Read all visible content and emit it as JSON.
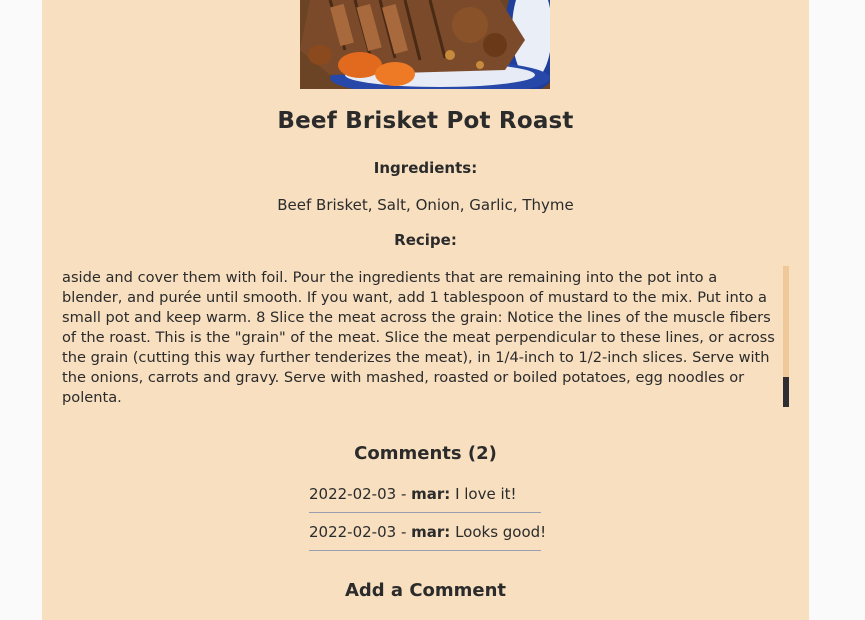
{
  "recipe": {
    "title": "Beef Brisket Pot Roast",
    "ingredients_label": "Ingredients:",
    "ingredients": "Beef Brisket, Salt, Onion, Garlic, Thyme",
    "recipe_label": "Recipe:",
    "recipe_text": "aside and cover them with foil. Pour the ingredients that are remaining into the pot into a blender, and purée until smooth. If you want, add 1 tablespoon of mustard to the mix. Put into a small pot and keep warm. 8 Slice the meat across the grain: Notice the lines of the muscle fibers of the roast. This is the \"grain\" of the meat. Slice the meat perpendicular to these lines, or across the grain (cutting this way further tenderizes the meat), in 1/4-inch to 1/2-inch slices. Serve with the onions, carrots and gravy. Serve with mashed, roasted or boiled potatoes, egg noodles or polenta."
  },
  "comments": {
    "title": "Comments (2)",
    "items": [
      {
        "date": "2022-02-03",
        "separator": " - ",
        "author": "mar:",
        "text": " I love it!"
      },
      {
        "date": "2022-02-03",
        "separator": " - ",
        "author": "mar:",
        "text": " Looks good!"
      }
    ]
  },
  "add_comment": {
    "title": "Add a Comment"
  },
  "colors": {
    "card_background": "#f7dfc0",
    "page_background": "#fafafa",
    "scroll_thumb": "#2f2f33"
  }
}
